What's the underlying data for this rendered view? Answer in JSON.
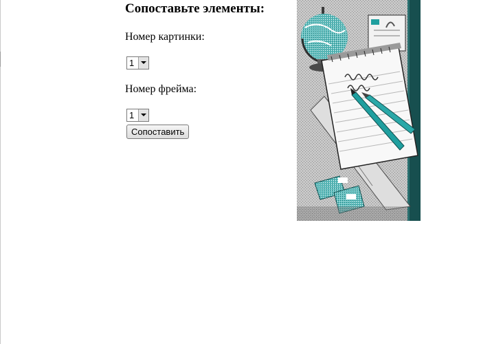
{
  "form": {
    "heading": "Сопоставьте элементы:",
    "picture_label": "Номер картинки:",
    "picture_select_value": "1",
    "frame_label": "Номер фрейма:",
    "frame_select_value": "1",
    "submit_label": "Сопоставить"
  },
  "colors": {
    "teal": "#1f9f9f",
    "dark_teal": "#174f4f",
    "gray_bg": "#bfbfbf"
  },
  "illustration": {
    "icon": "school-supplies-illustration"
  }
}
